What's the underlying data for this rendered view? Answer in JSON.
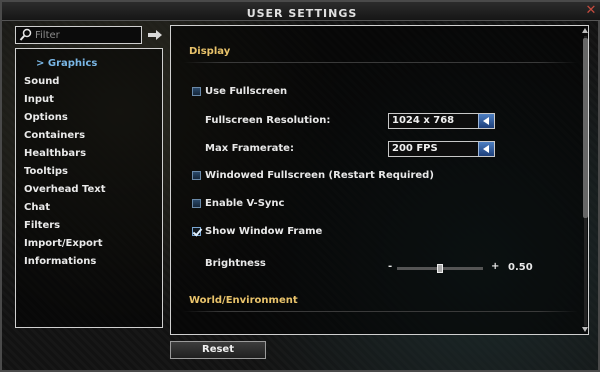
{
  "window": {
    "title": "USER SETTINGS",
    "close_glyph": "✕"
  },
  "filter": {
    "placeholder": "Filter",
    "value": "",
    "icon": "search-icon",
    "go_icon": "arrow-right-icon"
  },
  "sidebar": {
    "items": [
      {
        "label": "> Graphics",
        "active": true
      },
      {
        "label": "Sound"
      },
      {
        "label": "Input"
      },
      {
        "label": "Options"
      },
      {
        "label": "Containers"
      },
      {
        "label": "Healthbars"
      },
      {
        "label": "Tooltips"
      },
      {
        "label": "Overhead Text"
      },
      {
        "label": "Chat"
      },
      {
        "label": "Filters"
      },
      {
        "label": "Import/Export"
      },
      {
        "label": "Informations"
      }
    ]
  },
  "content": {
    "sections": [
      {
        "title": "Display"
      },
      {
        "title": "World/Environment"
      }
    ],
    "use_fullscreen": {
      "label": "Use Fullscreen",
      "checked": false
    },
    "fullscreen_resolution": {
      "label": "Fullscreen Resolution:",
      "value": "1024 x 768"
    },
    "max_framerate": {
      "label": "Max Framerate:",
      "value": "200 FPS"
    },
    "windowed_fullscreen": {
      "label": "Windowed Fullscreen (Restart Required)",
      "checked": false
    },
    "enable_vsync": {
      "label": "Enable V-Sync",
      "checked": false
    },
    "show_window_frame": {
      "label": "Show Window Frame",
      "checked": true
    },
    "brightness": {
      "label": "Brightness",
      "minus": "-",
      "plus": "+",
      "value": "0.50",
      "fraction": 0.5
    }
  },
  "footer": {
    "reset_label": "Reset"
  },
  "colors": {
    "section_title": "#e9c36b",
    "active_item": "#7ab7e6",
    "accent_blue": "#2b5a9a"
  }
}
